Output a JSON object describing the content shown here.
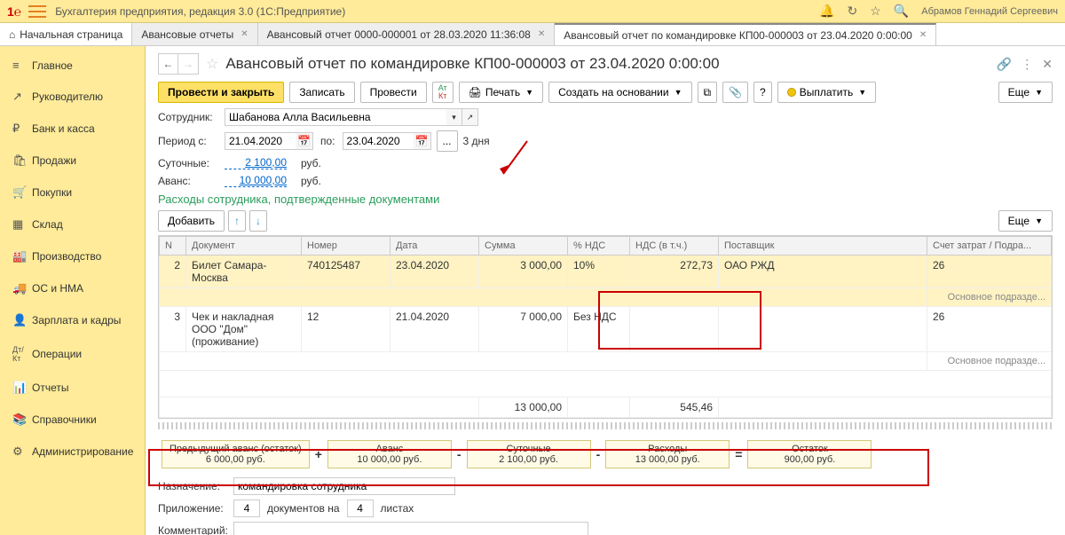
{
  "app": {
    "title": "Бухгалтерия предприятия, редакция 3.0   (1С:Предприятие)",
    "logo": "1℮",
    "user": "Абрамов Геннадий Сергеевич"
  },
  "tabs": {
    "home": "Начальная страница",
    "items": [
      {
        "label": "Авансовые отчеты"
      },
      {
        "label": "Авансовый отчет 0000-000001 от 28.03.2020 11:36:08"
      },
      {
        "label": "Авансовый отчет по командировке КП00-000003 от 23.04.2020 0:00:00"
      }
    ]
  },
  "sidebar": [
    {
      "icon": "≡",
      "label": "Главное"
    },
    {
      "icon": "↗",
      "label": "Руководителю"
    },
    {
      "icon": "₽",
      "label": "Банк и касса"
    },
    {
      "icon": "🛍",
      "label": "Продажи"
    },
    {
      "icon": "🛒",
      "label": "Покупки"
    },
    {
      "icon": "▦",
      "label": "Склад"
    },
    {
      "icon": "🏭",
      "label": "Производство"
    },
    {
      "icon": "🚚",
      "label": "ОС и НМА"
    },
    {
      "icon": "👤",
      "label": "Зарплата и кадры"
    },
    {
      "icon": "Дт/Кт",
      "label": "Операции"
    },
    {
      "icon": "📊",
      "label": "Отчеты"
    },
    {
      "icon": "📚",
      "label": "Справочники"
    },
    {
      "icon": "⚙",
      "label": "Администрирование"
    }
  ],
  "doc": {
    "title": "Авансовый отчет по командировке КП00-000003 от 23.04.2020 0:00:00",
    "buttons": {
      "post_close": "Провести и закрыть",
      "save": "Записать",
      "post": "Провести",
      "print": "Печать",
      "create_based": "Создать на основании",
      "pay": "Выплатить",
      "more": "Еще"
    }
  },
  "form": {
    "employee_lbl": "Сотрудник:",
    "employee": "Шабанова Алла Васильевна",
    "period_from_lbl": "Период с:",
    "period_from": "21.04.2020",
    "period_to_lbl": "по:",
    "period_to": "23.04.2020",
    "days": "3 дня",
    "perdiem_lbl": "Суточные:",
    "perdiem": "2 100,00",
    "rub": "руб.",
    "advance_lbl": "Аванс:",
    "advance": "10 000,00",
    "section": "Расходы сотрудника, подтвержденные документами",
    "add": "Добавить",
    "more2": "Еще"
  },
  "table": {
    "headers": {
      "n": "N",
      "doc": "Документ",
      "num": "Номер",
      "date": "Дата",
      "sum": "Сумма",
      "vat_pct": "% НДС",
      "vat": "НДС (в т.ч.)",
      "vendor": "Поставщик",
      "acct": "Счет затрат / Подра..."
    },
    "rows": [
      {
        "n": "2",
        "doc": "Билет Самара-Москва",
        "num": "740125487",
        "date": "23.04.2020",
        "sum": "3 000,00",
        "vat_pct": "10%",
        "vat": "272,73",
        "vendor": "ОАО РЖД",
        "acct": "26",
        "sub": "Основное подразде..."
      },
      {
        "n": "3",
        "doc": "Чек и накладная ООО \"Дом\" (проживание)",
        "num": "12",
        "date": "21.04.2020",
        "sum": "7 000,00",
        "vat_pct": "Без НДС",
        "vat": "",
        "vendor": "",
        "acct": "26",
        "sub": "Основное подразде..."
      }
    ],
    "totals": {
      "sum": "13 000,00",
      "vat": "545,46"
    }
  },
  "summary": {
    "prev": {
      "lbl": "Предыдущий аванс (остаток)",
      "val": "6 000,00 руб."
    },
    "adv": {
      "lbl": "Аванс",
      "val": "10 000,00 руб."
    },
    "perdiem": {
      "lbl": "Суточные",
      "val": "2 100,00 руб."
    },
    "exp": {
      "lbl": "Расходы",
      "val": "13 000,00 руб."
    },
    "rest": {
      "lbl": "Остаток",
      "val": "900,00 руб."
    }
  },
  "footer": {
    "purpose_lbl": "Назначение:",
    "purpose": "командировка сотрудника",
    "attach_lbl": "Приложение:",
    "attach_n1": "4",
    "attach_mid": "документов на",
    "attach_n2": "4",
    "attach_end": "листах",
    "comment_lbl": "Комментарий:"
  }
}
